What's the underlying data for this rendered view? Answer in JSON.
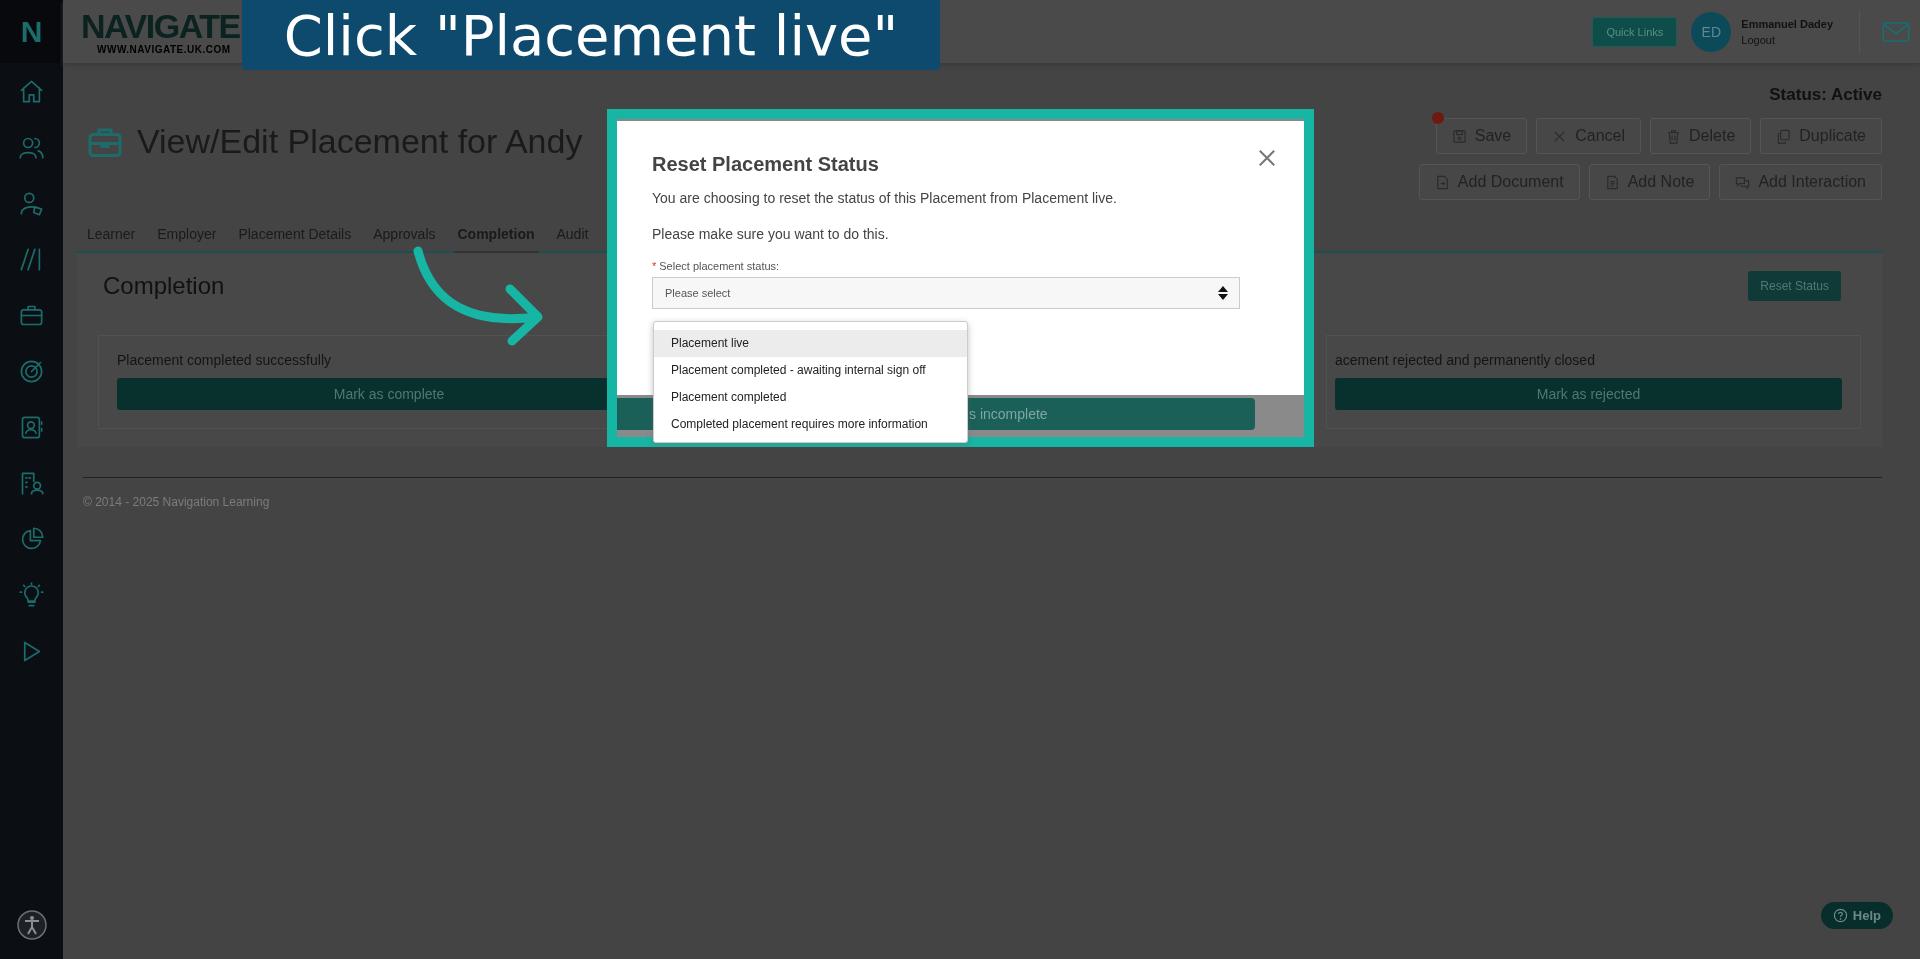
{
  "banner": {
    "text": "Click \"Placement live\""
  },
  "sidebar": {
    "logo": "N",
    "items": [
      {
        "kind": "home"
      },
      {
        "kind": "users"
      },
      {
        "kind": "user-tag"
      },
      {
        "kind": "slashes"
      },
      {
        "kind": "briefcase"
      },
      {
        "kind": "target"
      },
      {
        "kind": "contact"
      },
      {
        "kind": "building"
      },
      {
        "kind": "pie"
      },
      {
        "kind": "bulb"
      },
      {
        "kind": "play"
      }
    ]
  },
  "header": {
    "logo": "NAVIGATE",
    "logo_url": "WWW.NAVIGATE.UK.COM",
    "quick_links": "Quick Links",
    "user": {
      "initials": "ED",
      "name": "Emmanuel Dadey",
      "logout": "Logout"
    }
  },
  "status": "Status: Active",
  "title": "View/Edit Placement for Andy",
  "actions": [
    {
      "label": "Save",
      "kind": "save",
      "notification": true
    },
    {
      "label": "Cancel",
      "kind": "cancel",
      "notification": false
    },
    {
      "label": "Delete",
      "kind": "delete",
      "notification": false
    },
    {
      "label": "Duplicate",
      "kind": "duplicate",
      "notification": false
    },
    {
      "label": "Add Document",
      "kind": "document",
      "notification": false
    },
    {
      "label": "Add Note",
      "kind": "note",
      "notification": false
    },
    {
      "label": "Add Interaction",
      "kind": "interaction",
      "notification": false
    }
  ],
  "tabs": [
    {
      "label": "Learner",
      "selected": false
    },
    {
      "label": "Employer",
      "selected": false
    },
    {
      "label": "Placement Details",
      "selected": false
    },
    {
      "label": "Approvals",
      "selected": false
    },
    {
      "label": "Completion",
      "selected": true
    },
    {
      "label": "Audit",
      "selected": false
    }
  ],
  "section": {
    "heading": "Completion",
    "reset_button": "Reset Status",
    "cards": [
      {
        "text": "Placement completed successfully",
        "button": "Mark as complete"
      },
      {
        "text": "acement rejected and permanently closed",
        "button": "Mark as rejected"
      }
    ]
  },
  "footer": "© 2014 - 2025 Navigation Learning",
  "help": "Help",
  "modal": {
    "title": "Reset Placement Status",
    "message": "You are choosing to reset the status of this Placement from Placement live.",
    "note": "Please make sure you want to do this.",
    "field_label": "Select placement status:",
    "required": true,
    "required_mark": "*",
    "placeholder": "Please select",
    "options": [
      {
        "label": "Placement live",
        "selected": true
      },
      {
        "label": "Placement completed - awaiting internal sign off",
        "selected": false
      },
      {
        "label": "Placement completed",
        "selected": false
      },
      {
        "label": "Completed placement requires more information",
        "selected": false
      }
    ],
    "behind_button": "s incomplete"
  }
}
